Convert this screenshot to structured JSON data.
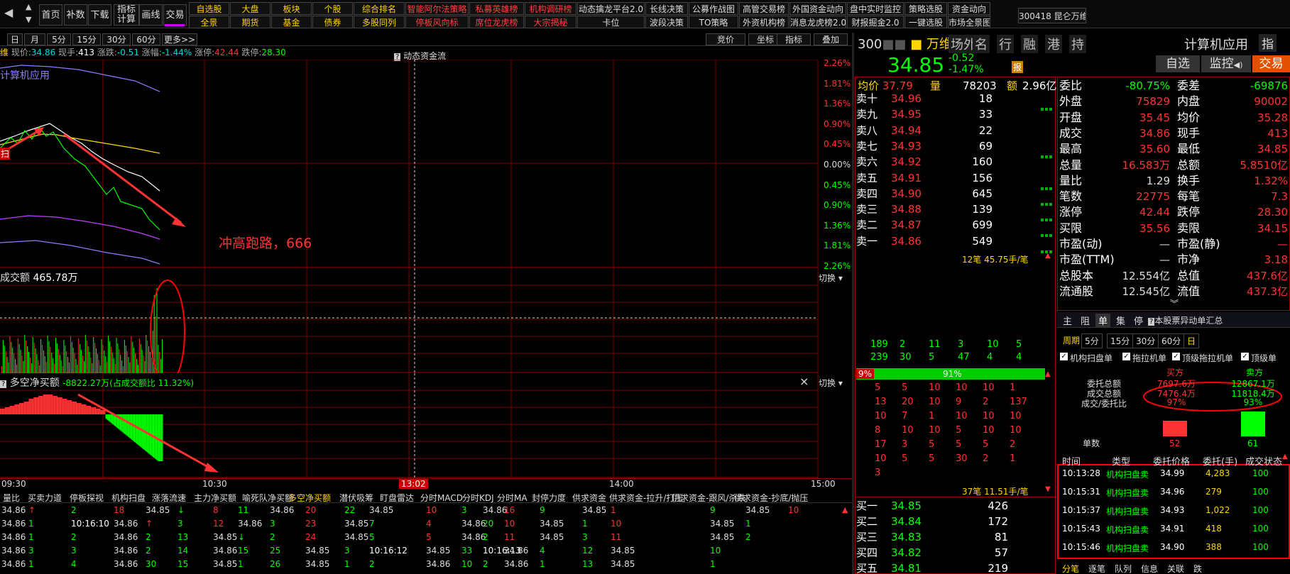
{
  "toolbar": {
    "nav": [
      "首页",
      "补数",
      "下载",
      "指标计算",
      "画线",
      "交易"
    ],
    "row1": [
      "自选股",
      "大盘",
      "板块",
      "个股",
      "综合排名",
      "智能阿尔法策略",
      "私募英雄榜",
      "机构调研榜",
      "动态擒龙平台2.0",
      "长线决策",
      "公募作战图",
      "高管交易榜",
      "外国资金动向",
      "盘中实时监控",
      "策略选股",
      "资金动向"
    ],
    "row2": [
      "全景",
      "期货",
      "基金",
      "债券",
      "多股同列",
      "停板风向标",
      "席位龙虎榜",
      "大宗揭秘",
      "卡位",
      "波段决策",
      "TO策略",
      "外资机构榜",
      "消息龙虎榜2.0",
      "财报掘金2.0",
      "一键选股",
      "市场全景图"
    ],
    "stock_tab": "300418 昆仑万维"
  },
  "periods": [
    "日",
    "月",
    "5分",
    "15分",
    "30分",
    "60分",
    "更多>>"
  ],
  "chart_tools": [
    "竞价",
    "坐标",
    "指标",
    "叠加"
  ],
  "info_line": {
    "name_tail": "维",
    "price_label": "现价:",
    "price": "34.86",
    "hand_label": "现手:",
    "hand": "413",
    "chg_label": "涨跌:",
    "chg": "-0.51",
    "pct_label": "涨幅:",
    "pct": "-1.44%",
    "up_label": "涨停:",
    "up": "42.44",
    "down_label": "跌停:",
    "down": "28.30"
  },
  "dyn_label": "动态资金流",
  "overlay_label": "计算机应用",
  "annotation": "冲高跑路，666",
  "right_axis": [
    "2.26%",
    "1.81%",
    "1.36%",
    "0.90%",
    "0.45%",
    "0.00%",
    "0.45%",
    "0.90%",
    "1.36%",
    "1.81%",
    "2.26%"
  ],
  "volume": {
    "label": "成交额",
    "value": "465.78万",
    "switch": "切换"
  },
  "flow": {
    "label": "多空净买额",
    "value": "-8822.27万(占成交额比 11.32%)",
    "switch": "切换",
    "close": "×"
  },
  "time_axis": [
    "09:30",
    "10:30",
    "13:02",
    "14:00",
    "15:00"
  ],
  "bottom_tabs": [
    "量比",
    "买卖力道",
    "停板探视",
    "机构扫盘",
    "涨落流速",
    "主力净买额",
    "喻死队净买额",
    "多空净买额",
    "潜伏吸筹",
    "盯盘雷达",
    "分时MACD",
    "分时KDJ",
    "分时MA",
    "封停力度",
    "供求资金",
    "供求资金-拉升/打压",
    "供求资金-跟风/杀跌",
    "供求资金-抄底/抛压"
  ],
  "bottom_rows": [
    [
      "34.86",
      "↑",
      "2",
      "18",
      "34.85",
      "↓",
      "8",
      "11",
      "34.86",
      "20",
      "22",
      "34.85",
      "10",
      "3",
      "34.86",
      "16",
      "9",
      "34.85",
      "1",
      "9",
      "34.85",
      "10"
    ],
    [
      "34.86",
      "1",
      "10:16:10",
      "34.86",
      "↑",
      "3",
      "12",
      "34.86",
      "3",
      "23",
      "34.85",
      "7",
      "4",
      "34.86",
      "20",
      "10",
      "34.85",
      "1",
      "10",
      "34.85",
      "1"
    ],
    [
      "34.86",
      "1",
      "2",
      "34.86",
      "2",
      "13",
      "34.85",
      "↓",
      "2",
      "24",
      "34.85",
      "5",
      "5",
      "34.86",
      "2",
      "11",
      "34.85",
      "3",
      "11",
      "34.85",
      "2"
    ],
    [
      "34.86",
      "3",
      "3",
      "34.86",
      "2",
      "14",
      "34.86",
      "15",
      "25",
      "34.85",
      "3",
      "10:16:12",
      "34.85",
      "33",
      "10:16:13",
      "34.86",
      "4",
      "12",
      "34.85",
      "10"
    ],
    [
      "34.86",
      "1",
      "4",
      "34.86",
      "30",
      "15",
      "34.85",
      "1",
      "26",
      "34.85",
      "1",
      "2",
      "34.86",
      "10",
      "2",
      "34.86",
      "1",
      "13",
      "34.85",
      "1"
    ]
  ],
  "quote": {
    "code": "300",
    "name": "万维",
    "tags": [
      "场外",
      "名",
      "行",
      "融",
      "港",
      "持"
    ],
    "industry": "计算机应用",
    "ind_tag": "指",
    "price": "34.85",
    "chg": "-0.52",
    "pct": "-1.47%",
    "report": "报",
    "btn_self": "自选",
    "btn_watch": "监控",
    "btn_trade": "交易",
    "avg_label": "均价",
    "avg": "37.79",
    "vol_label": "量",
    "vol": "78203",
    "amt_label": "额",
    "amt": "2.96亿"
  },
  "asks": [
    {
      "l": "卖十",
      "p": "34.96",
      "v": "18"
    },
    {
      "l": "卖九",
      "p": "34.95",
      "v": "33"
    },
    {
      "l": "卖八",
      "p": "34.94",
      "v": "22"
    },
    {
      "l": "卖七",
      "p": "34.93",
      "v": "69"
    },
    {
      "l": "卖六",
      "p": "34.92",
      "v": "160"
    },
    {
      "l": "卖五",
      "p": "34.91",
      "v": "156"
    },
    {
      "l": "卖四",
      "p": "34.90",
      "v": "645"
    },
    {
      "l": "卖三",
      "p": "34.88",
      "v": "139"
    },
    {
      "l": "卖二",
      "p": "34.87",
      "v": "699"
    },
    {
      "l": "卖一",
      "p": "34.86",
      "v": "549"
    }
  ],
  "bids": [
    {
      "l": "买一",
      "p": "34.85",
      "v": "426"
    },
    {
      "l": "买二",
      "p": "34.84",
      "v": "172"
    },
    {
      "l": "买三",
      "p": "34.83",
      "v": "81"
    },
    {
      "l": "买四",
      "p": "34.82",
      "v": "57"
    },
    {
      "l": "买五",
      "p": "34.81",
      "v": "219"
    }
  ],
  "queue": {
    "top_label": "12笔 45.75手/笔",
    "top_rows": [
      [
        "189",
        "2",
        "11",
        "3",
        "10",
        "5"
      ],
      [
        "239",
        "30",
        "5",
        "47",
        "4",
        "4"
      ]
    ],
    "bar_left": "9%",
    "bar_mid": "91%",
    "rows": [
      [
        "5",
        "5",
        "10",
        "10",
        "10",
        "1"
      ],
      [
        "13",
        "20",
        "10",
        "9",
        "2",
        "137"
      ],
      [
        "10",
        "7",
        "1",
        "10",
        "10",
        "10"
      ],
      [
        "8",
        "10",
        "10",
        "5",
        "10",
        "10"
      ],
      [
        "17",
        "3",
        "5",
        "5",
        "5",
        "2"
      ],
      [
        "10",
        "5",
        "5",
        "30",
        "2",
        "1"
      ],
      [
        "3"
      ]
    ],
    "bottom_label": "37笔 11.51手/笔"
  },
  "stats": [
    [
      "委比",
      "-80.75%",
      "委差",
      "-69876"
    ],
    [
      "外盘",
      "75829",
      "内盘",
      "90002"
    ],
    [
      "开盘",
      "35.45",
      "均价",
      "35.28"
    ],
    [
      "成交",
      "34.86",
      "现手",
      "413"
    ],
    [
      "最高",
      "35.60",
      "最低",
      "34.85"
    ],
    [
      "总量",
      "16.583万",
      "总额",
      "5.8510亿"
    ],
    [
      "量比",
      "1.29",
      "换手",
      "1.32%"
    ],
    [
      "笔数",
      "22775",
      "每笔",
      "7.3"
    ],
    [
      "涨停",
      "42.44",
      "跌停",
      "28.30"
    ],
    [
      "买限",
      "35.56",
      "卖限",
      "34.15"
    ],
    [
      "市盈(动)",
      "—",
      "市盈(静)",
      "—"
    ],
    [
      "市盈(TTM)",
      "—",
      "市净",
      "3.18"
    ],
    [
      "总股本",
      "12.554亿",
      "总值",
      "437.6亿"
    ],
    [
      "流通股",
      "12.545亿",
      "流值",
      "437.3亿"
    ]
  ],
  "tabs2": [
    "主",
    "阻",
    "单",
    "集",
    "停"
  ],
  "tabs2_note": "本股票异动单汇总",
  "periods2": [
    "周期",
    "5分",
    "15分",
    "30分",
    "60分",
    "日"
  ],
  "checks": [
    "机构扫盘单",
    "拖拉机单",
    "顶级拖拉机单",
    "顶级单"
  ],
  "summary": {
    "buy": "买方",
    "sell": "卖方",
    "rows": [
      [
        "委托总额",
        "7697.6万",
        "12867.1万"
      ],
      [
        "成交总额",
        "7476.4万",
        "11818.4万"
      ],
      [
        "成交/委托比",
        "97%",
        "93%"
      ]
    ],
    "count_label": "单数",
    "buy_count": "52",
    "sell_count": "61",
    "buy_ratio": 0.46,
    "sell_ratio": 0.54
  },
  "trades_head": [
    "时间",
    "类型",
    "委托价格",
    "委托(手)",
    "成交状态"
  ],
  "trades": [
    [
      "10:13:28",
      "机构扫盘卖",
      "34.99",
      "4,283",
      "100"
    ],
    [
      "10:15:31",
      "机构扫盘卖",
      "34.96",
      "279",
      "100"
    ],
    [
      "10:15:37",
      "机构扫盘卖",
      "34.93",
      "1,022",
      "100"
    ],
    [
      "10:15:43",
      "机构扫盘卖",
      "34.91",
      "418",
      "100"
    ],
    [
      "10:15:46",
      "机构扫盘卖",
      "34.90",
      "388",
      "100"
    ]
  ],
  "bottom_tabs2": [
    "分笔",
    "逐笔",
    "队列",
    "信息",
    "关联",
    "跌"
  ],
  "colors": {
    "up": "#ff3333",
    "down": "#00ff00",
    "price": "#ffd400",
    "grid": "#7a0000"
  }
}
